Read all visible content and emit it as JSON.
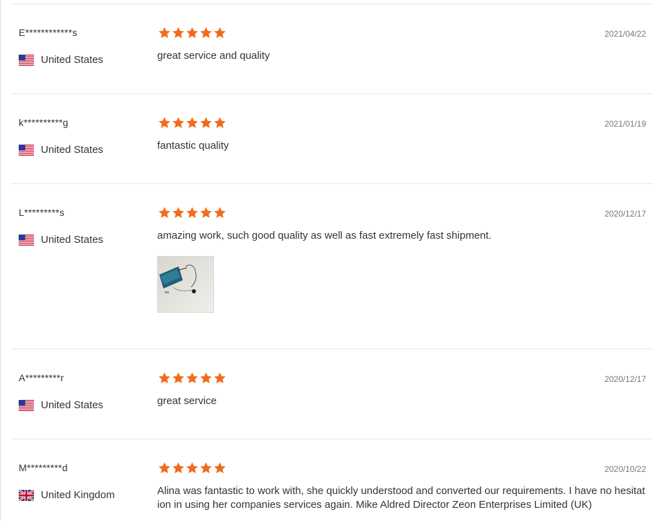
{
  "colors": {
    "star": "#f26a1b",
    "divider": "#e8e8e8",
    "text": "#333333",
    "date": "#777777"
  },
  "reviews": [
    {
      "name": "E************s",
      "country": "United States",
      "flag": "us-flag-icon",
      "rating": 5,
      "date": "2021/04/22",
      "text": "great service and quality"
    },
    {
      "name": "k**********g",
      "country": "United States",
      "flag": "us-flag-icon",
      "rating": 5,
      "date": "2021/01/19",
      "text": "fantastic quality"
    },
    {
      "name": "L*********s",
      "country": "United States",
      "flag": "us-flag-icon",
      "rating": 5,
      "date": "2020/12/17",
      "text": "amazing work, such good quality as well as fast extremely fast shipment.",
      "has_photo": true
    },
    {
      "name": "A*********r",
      "country": "United States",
      "flag": "us-flag-icon",
      "rating": 5,
      "date": "2020/12/17",
      "text": "great service"
    },
    {
      "name": "M*********d",
      "country": "United Kingdom",
      "flag": "uk-flag-icon",
      "rating": 5,
      "date": "2020/10/22",
      "text": "Alina was fantastic to work with, she quickly understood and converted our requirements. I have no hesitation in using her companies services again. Mike Aldred Director Zeon Enterprises Limited (UK)"
    }
  ]
}
